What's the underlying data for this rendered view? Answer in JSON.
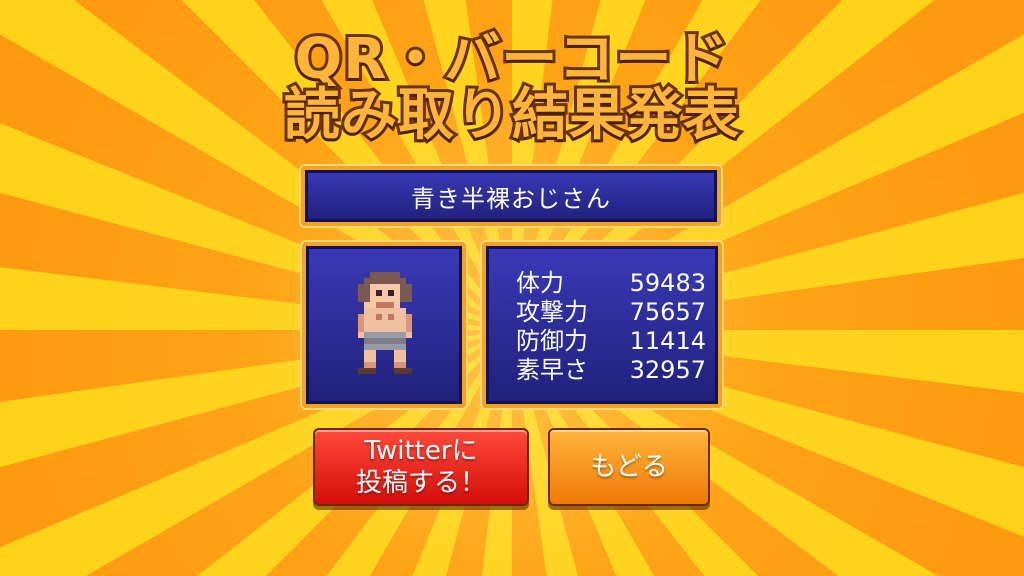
{
  "title": {
    "line1": "QR・バーコード",
    "line2": "読み取り結果発表"
  },
  "character": {
    "name": "青き半裸おじさん",
    "sprite_icon": "pixel-character-shirtless-man-icon"
  },
  "stats": [
    {
      "label": "体力",
      "value": "59483"
    },
    {
      "label": "攻撃力",
      "value": "75657"
    },
    {
      "label": "防御力",
      "value": "11414"
    },
    {
      "label": "素早さ",
      "value": "32957"
    }
  ],
  "buttons": {
    "tweet_line1": "Twitterに",
    "tweet_line2": "投稿する！",
    "back": "もどる"
  },
  "colors": {
    "panel": "#2a2a9a",
    "panel_border": "#f5a21c",
    "tweet_button": "#e8201a",
    "back_button": "#f89020",
    "title_fill": "#ffb53a",
    "title_outline": "#6a3410"
  }
}
